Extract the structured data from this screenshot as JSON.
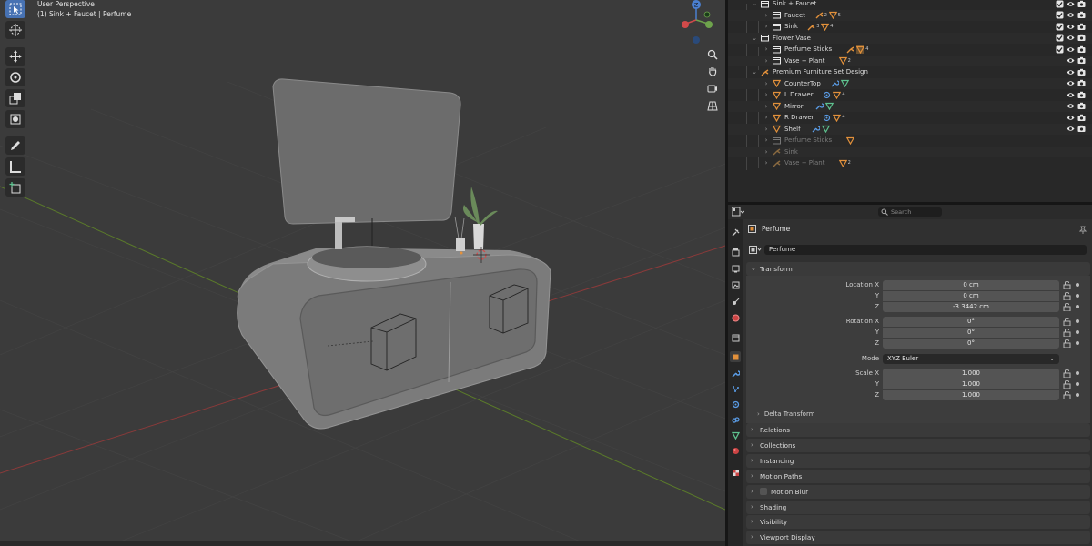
{
  "viewport": {
    "title": "User Perspective",
    "subtitle": "(1) Sink + Faucet | Perfume",
    "tools": [
      "select-box",
      "cursor",
      "move",
      "rotate",
      "scale",
      "transform",
      "annotate",
      "measure",
      "add-cube"
    ],
    "nav_buttons": [
      "zoom",
      "pan",
      "camera",
      "grid"
    ],
    "gizmo_axis_label": "Z"
  },
  "outliner": {
    "rows": [
      {
        "label": "Sink + Faucet",
        "kind": "collection",
        "depth": 1,
        "checkbox": true,
        "eye": true,
        "cam": true
      },
      {
        "label": "Faucet",
        "kind": "object",
        "depth": 2,
        "tags": [
          {
            "icon": "armature",
            "n": "2"
          },
          {
            "icon": "mesh",
            "n": "5"
          }
        ],
        "checkbox": true,
        "eye": true,
        "cam": true
      },
      {
        "label": "Sink",
        "kind": "object",
        "depth": 2,
        "tags": [
          {
            "icon": "armature",
            "n": "3"
          },
          {
            "icon": "mesh",
            "n": "4"
          }
        ],
        "checkbox": true,
        "eye": true,
        "cam": true
      },
      {
        "label": "Flower Vase",
        "kind": "collection",
        "depth": 1,
        "checkbox": true,
        "eye": true,
        "cam": true
      },
      {
        "label": "Perfume Sticks",
        "kind": "object",
        "depth": 2,
        "tags": [
          {
            "icon": "armature",
            "n": ""
          },
          {
            "icon": "mesh-selected",
            "n": "4"
          }
        ],
        "checkbox": true,
        "eye": true,
        "cam": true
      },
      {
        "label": "Vase + Plant",
        "kind": "object",
        "depth": 2,
        "tags": [
          {
            "icon": "mesh",
            "n": "2"
          }
        ],
        "checkbox": false,
        "eye": true,
        "cam": true
      },
      {
        "label": "Premium Furniture Set Design",
        "kind": "armature",
        "depth": 1,
        "checkbox": false,
        "eye": true,
        "cam": true
      },
      {
        "label": "CounterTop",
        "kind": "mesh",
        "depth": 2,
        "tags": [
          {
            "icon": "modifier",
            "n": ""
          },
          {
            "icon": "data",
            "n": ""
          }
        ],
        "checkbox": false,
        "eye": true,
        "cam": true
      },
      {
        "label": "L Drawer",
        "kind": "mesh",
        "depth": 2,
        "tags": [
          {
            "icon": "material",
            "n": ""
          },
          {
            "icon": "mesh",
            "n": "4"
          }
        ],
        "checkbox": false,
        "eye": true,
        "cam": true
      },
      {
        "label": "Mirror",
        "kind": "mesh",
        "depth": 2,
        "tags": [
          {
            "icon": "modifier",
            "n": ""
          },
          {
            "icon": "data",
            "n": ""
          }
        ],
        "checkbox": false,
        "eye": true,
        "cam": true
      },
      {
        "label": "R Drawer",
        "kind": "mesh",
        "depth": 2,
        "tags": [
          {
            "icon": "material",
            "n": ""
          },
          {
            "icon": "mesh",
            "n": "4"
          }
        ],
        "checkbox": false,
        "eye": true,
        "cam": true
      },
      {
        "label": "Shelf",
        "kind": "mesh",
        "depth": 2,
        "tags": [
          {
            "icon": "modifier",
            "n": ""
          },
          {
            "icon": "data",
            "n": ""
          }
        ],
        "checkbox": false,
        "eye": true,
        "cam": true
      },
      {
        "label": "Perfume Sticks",
        "kind": "dim-object",
        "depth": 2,
        "tags": [
          {
            "icon": "mesh",
            "n": ""
          }
        ],
        "checkbox": false,
        "eye": false,
        "cam": false
      },
      {
        "label": "Sink",
        "kind": "dim-armature",
        "depth": 2,
        "tags": [],
        "checkbox": false,
        "eye": false,
        "cam": false
      },
      {
        "label": "Vase + Plant",
        "kind": "dim-armature",
        "depth": 2,
        "tags": [
          {
            "icon": "mesh",
            "n": "2"
          }
        ],
        "checkbox": false,
        "eye": false,
        "cam": false
      }
    ]
  },
  "properties": {
    "search_placeholder": "Search",
    "object_header": "Perfume",
    "object_name": "Perfume",
    "transform": {
      "title": "Transform",
      "location_label": "Location X",
      "location": {
        "x": "0 cm",
        "y": "0 cm",
        "z": "-3.3442 cm"
      },
      "rotation_label": "Rotation X",
      "rotation": {
        "x": "0°",
        "y": "0°",
        "z": "0°"
      },
      "mode_label": "Mode",
      "mode": "XYZ Euler",
      "scale_label": "Scale X",
      "scale": {
        "x": "1.000",
        "y": "1.000",
        "z": "1.000"
      },
      "axis_y": "Y",
      "axis_z": "Z",
      "delta": "Delta Transform"
    },
    "panels": [
      "Relations",
      "Collections",
      "Instancing",
      "Motion Paths",
      "Motion Blur",
      "Shading",
      "Visibility",
      "Viewport Display"
    ]
  },
  "colors": {
    "accent": "#4772b3",
    "orange": "#e3913b",
    "green": "#5ec28f",
    "blue": "#5a9ce6",
    "axis_red": "#8a3a3a",
    "axis_green": "#5a7a2a"
  }
}
